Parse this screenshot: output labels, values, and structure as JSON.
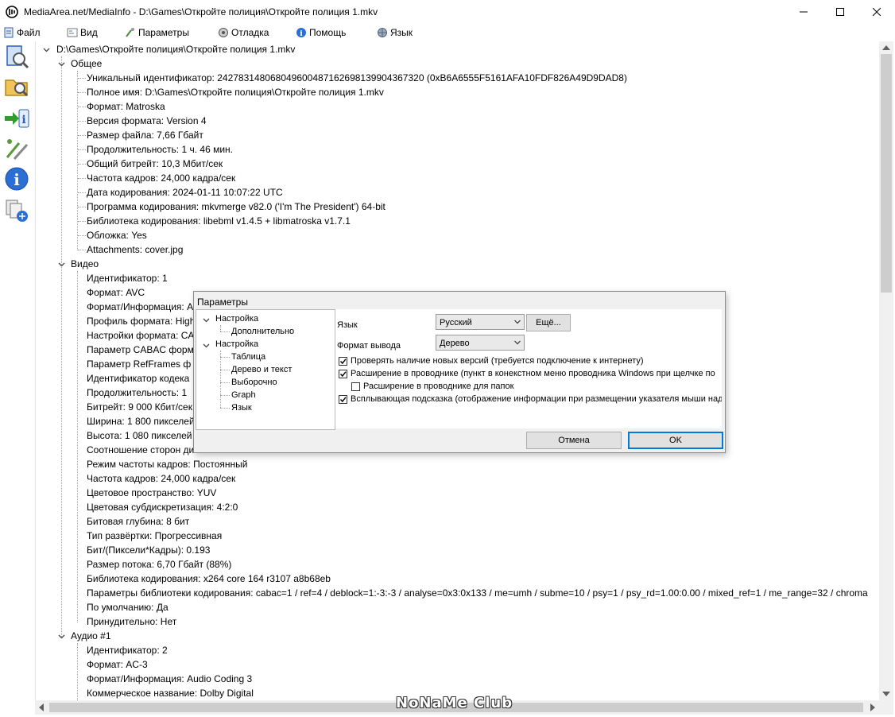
{
  "window": {
    "title": "MediaArea.net/MediaInfo - D:\\Games\\Откройте полиция\\Откройте полиция 1.mkv"
  },
  "menu": [
    {
      "label": "Файл",
      "icon": "file-icon"
    },
    {
      "label": "Вид",
      "icon": "view-icon"
    },
    {
      "label": "Параметры",
      "icon": "options-icon"
    },
    {
      "label": "Отладка",
      "icon": "debug-icon"
    },
    {
      "label": "Помощь",
      "icon": "help-icon"
    },
    {
      "label": "Язык",
      "icon": "language-icon"
    }
  ],
  "toolbar": [
    "open-file-icon",
    "open-folder-icon",
    "export-icon",
    "preferences-icon",
    "about-icon",
    "knowledge-icon"
  ],
  "tree": {
    "root": "D:\\Games\\Откройте полиция\\Откройте полиция 1.mkv",
    "sections": [
      {
        "name": "Общее",
        "items": [
          "Уникальный идентификатор: 242783148068049600487162698139904367320 (0xB6A6555F5161AFA10FDF826A49D9DAD8)",
          "Полное имя: D:\\Games\\Откройте полиция\\Откройте полиция 1.mkv",
          "Формат: Matroska",
          "Версия формата: Version 4",
          "Размер файла: 7,66 Гбайт",
          "Продолжительность: 1 ч. 46 мин.",
          "Общий битрейт: 10,3 Мбит/сек",
          "Частота кадров: 24,000 кадра/сек",
          "Дата кодирования: 2024-01-11 10:07:22 UTC",
          "Программа кодирования: mkvmerge v82.0 ('I'm The President') 64-bit",
          "Библиотека кодирования: libebml v1.4.5 + libmatroska v1.7.1",
          "Обложка: Yes",
          "Attachments: cover.jpg"
        ]
      },
      {
        "name": "Видео",
        "items": [
          "Идентификатор: 1",
          "Формат: AVC",
          "Формат/Информация: A",
          "Профиль формата: High",
          "Настройки формата: CA",
          "Параметр CABAC форм",
          "Параметр RefFrames ф",
          "Идентификатор кодека",
          "Продолжительность: 1",
          "Битрейт: 9 000 Кбит/сек",
          "Ширина: 1 800 пикселей",
          "Высота: 1 080 пикселей",
          "Соотношение сторон ди",
          "Режим частоты кадров: Постоянный",
          "Частота кадров: 24,000 кадра/сек",
          "Цветовое пространство: YUV",
          "Цветовая субдискретизация: 4:2:0",
          "Битовая глубина: 8 бит",
          "Тип развёртки: Прогрессивная",
          "Бит/(Пиксели*Кадры): 0.193",
          "Размер потока: 6,70 Гбайт (88%)",
          "Библиотека кодирования: x264 core 164 r3107 a8b68eb",
          "Параметры библиотеки кодирования: cabac=1 / ref=4 / deblock=1:-3:-3 / analyse=0x3:0x133 / me=umh / subme=10 / psy=1 / psy_rd=1.00:0.00 / mixed_ref=1 / me_range=32 / chroma",
          "По умолчанию: Да",
          "Принудительно: Нет"
        ]
      },
      {
        "name": "Аудио #1",
        "items": [
          "Идентификатор: 2",
          "Формат: AC-3",
          "Формат/Информация: Audio Coding 3",
          "Коммерческое название: Dolby Digital"
        ]
      }
    ]
  },
  "dialog": {
    "title": "Параметры",
    "tree": {
      "group1": "Настройка",
      "group1_child": "Дополнительно",
      "group2": "Настройка",
      "group2_children": [
        "Таблица",
        "Дерево и текст",
        "Выборочно",
        "Graph",
        "Язык"
      ]
    },
    "language_label": "Язык",
    "language_value": "Русский",
    "more_button": "Ещё...",
    "output_label": "Формат вывода",
    "output_value": "Дерево",
    "checkboxes": [
      {
        "label": "Проверять наличие новых версий (требуется подключение к интернету)",
        "checked": true
      },
      {
        "label": "Расширение в проводнике (пункт в конекстном меню проводника Windows при щелчке по",
        "checked": true
      },
      {
        "label": "Расширение в проводнике для папок",
        "checked": false
      },
      {
        "label": "Всплывающая подсказка (отображение информации при размещении указателя мыши над",
        "checked": true
      }
    ],
    "cancel": "Отмена",
    "ok": "OK"
  },
  "watermark": "NoNaMe Club"
}
